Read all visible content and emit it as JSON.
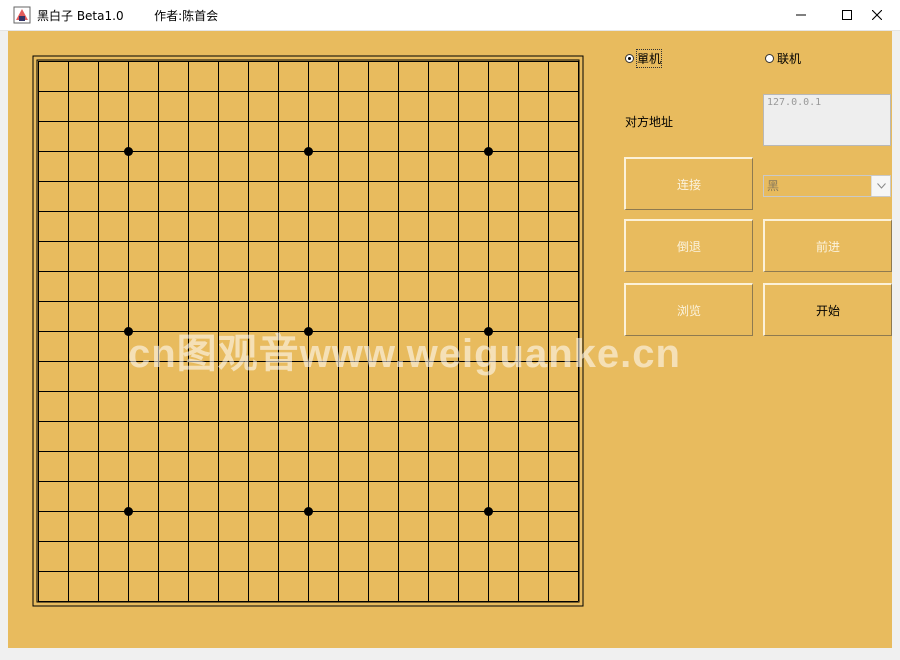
{
  "window": {
    "title": "黑白子 Beta1.0        作者:陈首会",
    "icon": "app-icon",
    "controls": [
      "minimize-icon",
      "maximize-icon",
      "close-icon"
    ]
  },
  "board": {
    "size": 19,
    "star_points": [
      [
        3,
        3
      ],
      [
        3,
        9
      ],
      [
        3,
        15
      ],
      [
        9,
        3
      ],
      [
        9,
        9
      ],
      [
        9,
        15
      ],
      [
        15,
        3
      ],
      [
        15,
        9
      ],
      [
        15,
        15
      ]
    ]
  },
  "mode": {
    "single": {
      "label": "單机",
      "selected": true
    },
    "online": {
      "label": "联机",
      "selected": false
    }
  },
  "address": {
    "label": "对方地址",
    "value": "127.0.0.1"
  },
  "buttons": {
    "connect": "连接",
    "undo": "倒退",
    "forward": "前进",
    "browse": "浏览",
    "start": "开始"
  },
  "color_select": {
    "value": "黑",
    "icon": "chevron-down-icon"
  },
  "watermark": "cn图观音www.weiguanke.cn",
  "colors": {
    "panel": "#e8bb5e",
    "line": "#000000"
  }
}
